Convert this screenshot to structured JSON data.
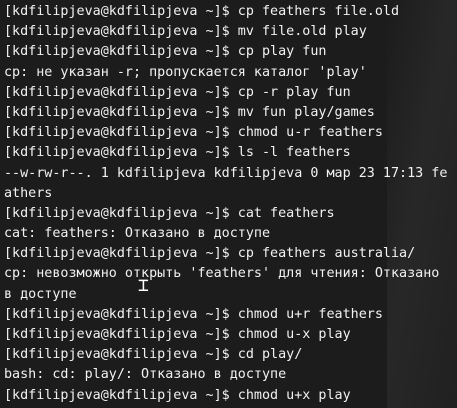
{
  "terminal": {
    "lines": [
      "[kdfilipjeva@kdfilipjeva ~]$ cp feathers file.old",
      "[kdfilipjeva@kdfilipjeva ~]$ mv file.old play",
      "[kdfilipjeva@kdfilipjeva ~]$ cp play fun",
      "cp: не указан -r; пропускается каталог 'play'",
      "[kdfilipjeva@kdfilipjeva ~]$ cp -r play fun",
      "[kdfilipjeva@kdfilipjeva ~]$ mv fun play/games",
      "[kdfilipjeva@kdfilipjeva ~]$ chmod u-r feathers",
      "[kdfilipjeva@kdfilipjeva ~]$ ls -l feathers",
      "--w-rw-r--. 1 kdfilipjeva kdfilipjeva 0 мар 23 17:13 fe",
      "athers",
      "[kdfilipjeva@kdfilipjeva ~]$ cat feathers",
      "cat: feathers: Отказано в доступе",
      "[kdfilipjeva@kdfilipjeva ~]$ cp feathers australia/",
      "cp: невозможно открыть 'feathers' для чтения: Отказано",
      "в доступе",
      "[kdfilipjeva@kdfilipjeva ~]$ chmod u+r feathers",
      "[kdfilipjeva@kdfilipjeva ~]$ chmod u-x play",
      "[kdfilipjeva@kdfilipjeva ~]$ cd play/",
      "bash: cd: play/: Отказано в доступе",
      "[kdfilipjeva@kdfilipjeva ~]$ chmod u+x play"
    ]
  },
  "cursor": {
    "icon": "i-beam-cursor-icon"
  }
}
